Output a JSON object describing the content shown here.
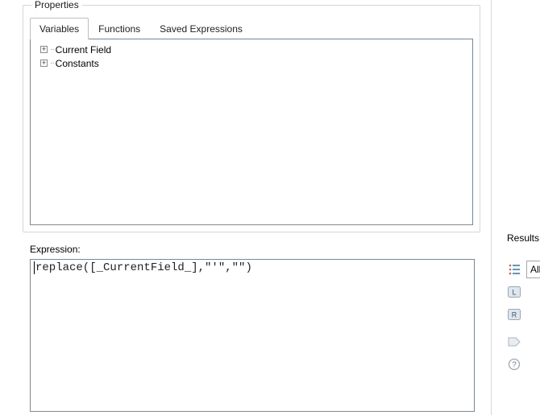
{
  "properties": {
    "legend": "Properties",
    "tabs": [
      {
        "label": "Variables",
        "active": true
      },
      {
        "label": "Functions",
        "active": false
      },
      {
        "label": "Saved Expressions",
        "active": false
      }
    ],
    "tree": [
      {
        "label": "Current Field",
        "expandable": true
      },
      {
        "label": "Constants",
        "expandable": true
      }
    ]
  },
  "expression": {
    "label": "Expression:",
    "value": "replace([_CurrentField_],\"'\",\"\")"
  },
  "results": {
    "label": "Results",
    "dropdown_value": "All"
  }
}
